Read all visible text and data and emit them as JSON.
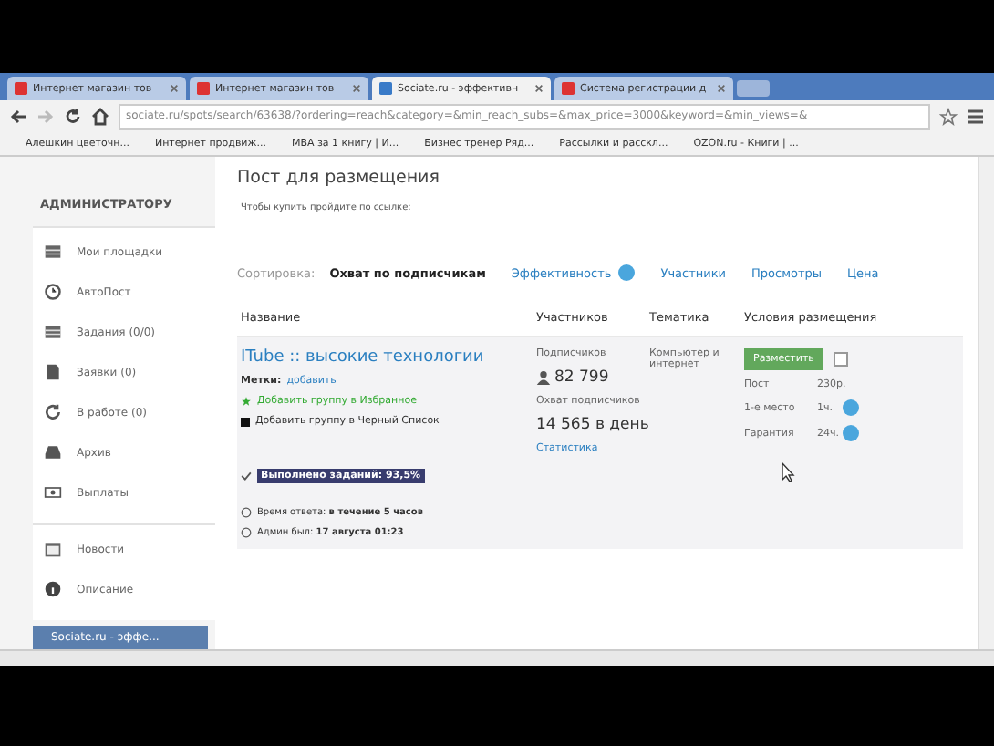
{
  "browser": {
    "tabs": [
      {
        "title": "Интернет магазин тов",
        "selected": false
      },
      {
        "title": "Интернет магазин тов",
        "selected": false
      },
      {
        "title": "Sociate.ru - эффективн",
        "selected": true
      },
      {
        "title": "Система регистрации д",
        "selected": false
      }
    ],
    "address": "sociate.ru/spots/search/63638/?ordering=reach&category=&min_reach_subs=&max_price=3000&keyword=&min_views=&",
    "bookmarks": [
      "Алешкин цветочн...",
      "Интернет продвиж...",
      "MBA за 1 книгу | И...",
      "Бизнес тренер Ряд...",
      "Рассылки и расскл...",
      "OZON.ru - Книги | ..."
    ]
  },
  "sidebar": {
    "heading": "АДМИНИСТРАТОРУ",
    "groups": [
      [
        {
          "label": "Мои площадки",
          "kind": "list"
        },
        {
          "label": "АвтоПост",
          "kind": "clock"
        },
        {
          "label": "Задания (0/0)",
          "kind": "list"
        },
        {
          "label": "Заявки (0)",
          "kind": "doc"
        },
        {
          "label": "В работе (0)",
          "kind": "refresh"
        },
        {
          "label": "Архив",
          "kind": "tray"
        },
        {
          "label": "Выплаты",
          "kind": "money"
        }
      ],
      [
        {
          "label": "Новости",
          "kind": "calendar"
        },
        {
          "label": "Описание",
          "kind": "info"
        }
      ]
    ],
    "promo": "Sociate.ru - эффе..."
  },
  "main": {
    "title": "Пост для размещения",
    "note": "Чтобы купить пройдите по ссылке:",
    "sort": {
      "label": "Сортировка:",
      "options": [
        {
          "label": "Охват по подписчикам",
          "selected": true,
          "help": false
        },
        {
          "label": "Эффективность",
          "selected": false,
          "help": true
        },
        {
          "label": "Участники",
          "selected": false,
          "help": false
        },
        {
          "label": "Просмотры",
          "selected": false,
          "help": false
        },
        {
          "label": "Цена",
          "selected": false,
          "help": false
        }
      ]
    },
    "table": {
      "columns": [
        "Название",
        "Участников",
        "Тематика",
        "Условия размещения"
      ],
      "rows": [
        {
          "name": "ITube :: высокие технологии",
          "tags_label": "Метки:",
          "tags_link": "добавить",
          "favorite": "Добавить группу в Избранное",
          "blacklist": "Добавить группу в Черный Список",
          "completed": "Выполнено заданий: 93,5%",
          "response_label": "Время ответа:",
          "response": "в течение 5 часов",
          "admin_label": "Админ был:",
          "admin": "17 августа 01:23",
          "subscribers_label": "Подписчиков",
          "subscribers": "82 799",
          "reach_label": "Охват подписчиков",
          "reach": "14 565 в день",
          "stats": "Статистика",
          "topic": "Компьютер и интернет",
          "button": "Разместить",
          "checked": false,
          "prices": [
            {
              "label": "Пост",
              "value": "230р.",
              "help": false
            },
            {
              "label": "1-е место",
              "value": "1ч.",
              "help": true
            },
            {
              "label": "Гарантия",
              "value": "24ч.",
              "help": true
            }
          ]
        }
      ]
    }
  }
}
